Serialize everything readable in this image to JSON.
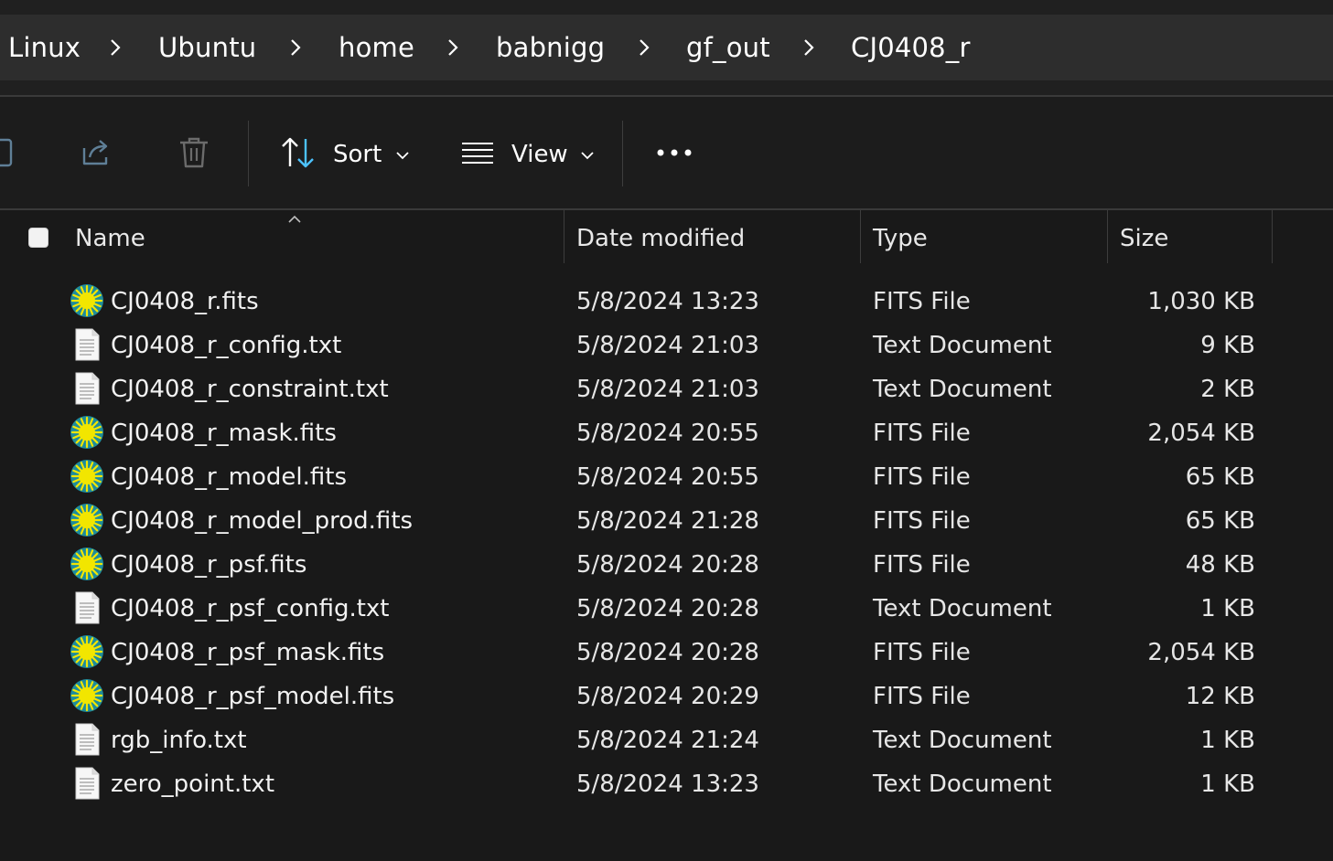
{
  "breadcrumb": [
    "Linux",
    "Ubuntu",
    "home",
    "babnigg",
    "gf_out",
    "CJ0408_r"
  ],
  "toolbar": {
    "sort_label": "Sort",
    "view_label": "View"
  },
  "columns": {
    "name": "Name",
    "date": "Date modified",
    "type": "Type",
    "size": "Size"
  },
  "files": [
    {
      "name": "CJ0408_r.fits",
      "date": "5/8/2024 13:23",
      "type": "FITS File",
      "size": "1,030 KB",
      "icon": "fits-file-icon"
    },
    {
      "name": "CJ0408_r_config.txt",
      "date": "5/8/2024 21:03",
      "type": "Text Document",
      "size": "9 KB",
      "icon": "text-file-icon"
    },
    {
      "name": "CJ0408_r_constraint.txt",
      "date": "5/8/2024 21:03",
      "type": "Text Document",
      "size": "2 KB",
      "icon": "text-file-icon"
    },
    {
      "name": "CJ0408_r_mask.fits",
      "date": "5/8/2024 20:55",
      "type": "FITS File",
      "size": "2,054 KB",
      "icon": "fits-file-icon"
    },
    {
      "name": "CJ0408_r_model.fits",
      "date": "5/8/2024 20:55",
      "type": "FITS File",
      "size": "65 KB",
      "icon": "fits-file-icon"
    },
    {
      "name": "CJ0408_r_model_prod.fits",
      "date": "5/8/2024 21:28",
      "type": "FITS File",
      "size": "65 KB",
      "icon": "fits-file-icon"
    },
    {
      "name": "CJ0408_r_psf.fits",
      "date": "5/8/2024 20:28",
      "type": "FITS File",
      "size": "48 KB",
      "icon": "fits-file-icon"
    },
    {
      "name": "CJ0408_r_psf_config.txt",
      "date": "5/8/2024 20:28",
      "type": "Text Document",
      "size": "1 KB",
      "icon": "text-file-icon"
    },
    {
      "name": "CJ0408_r_psf_mask.fits",
      "date": "5/8/2024 20:28",
      "type": "FITS File",
      "size": "2,054 KB",
      "icon": "fits-file-icon"
    },
    {
      "name": "CJ0408_r_psf_model.fits",
      "date": "5/8/2024 20:29",
      "type": "FITS File",
      "size": "12 KB",
      "icon": "fits-file-icon"
    },
    {
      "name": "rgb_info.txt",
      "date": "5/8/2024 21:24",
      "type": "Text Document",
      "size": "1 KB",
      "icon": "text-file-icon"
    },
    {
      "name": "zero_point.txt",
      "date": "5/8/2024 13:23",
      "type": "Text Document",
      "size": "1 KB",
      "icon": "text-file-icon"
    }
  ],
  "colors": {
    "background": "#191919",
    "address_bar": "#2d2d2d",
    "fits_icon_teal": "#1e8c9c",
    "fits_icon_yellow": "#f2e600"
  }
}
